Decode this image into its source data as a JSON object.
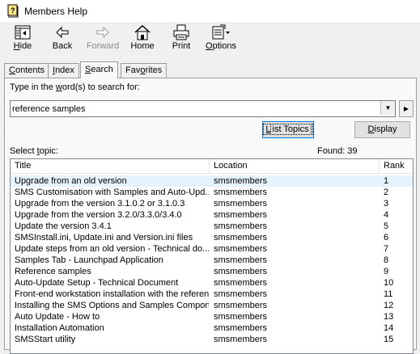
{
  "window": {
    "title": "Members Help"
  },
  "toolbar": {
    "buttons": [
      {
        "label": "Hide",
        "accel": "H",
        "rest": "ide"
      },
      {
        "label": "Back",
        "accel": "",
        "rest": "Back"
      },
      {
        "label": "Forward",
        "accel": "",
        "rest": "Forward"
      },
      {
        "label": "Home",
        "accel": "",
        "rest": "Home"
      },
      {
        "label": "Print",
        "accel": "",
        "rest": "Print"
      },
      {
        "label": "Options",
        "accel": "O",
        "rest": "ptions"
      }
    ]
  },
  "tabs": [
    {
      "label": "Contents",
      "pre": "",
      "accel": "C",
      "post": "ontents"
    },
    {
      "label": "Index",
      "pre": "",
      "accel": "I",
      "post": "ndex"
    },
    {
      "label": "Search",
      "pre": "",
      "accel": "S",
      "post": "earch"
    },
    {
      "label": "Favorites",
      "pre": "Fav",
      "accel": "o",
      "post": "rites"
    }
  ],
  "search": {
    "prompt_pre": "Type in the ",
    "prompt_accel": "w",
    "prompt_post": "ord(s) to search for:",
    "value": "reference samples",
    "list_topics_pre": "",
    "list_topics_accel": "L",
    "list_topics_post": "ist Topics",
    "display_pre": "",
    "display_accel": "D",
    "display_post": "isplay",
    "select_topic_pre": "Select ",
    "select_topic_accel": "t",
    "select_topic_post": "opic:",
    "found": "Found: 39"
  },
  "results": {
    "columns": [
      "Title",
      "Location",
      "Rank"
    ],
    "rows": [
      {
        "title": "Upgrade from an old version",
        "location": "smsmembers",
        "rank": "1"
      },
      {
        "title": "SMS Customisation with Samples and Auto-Upd...",
        "location": "smsmembers",
        "rank": "2"
      },
      {
        "title": "Upgrade from the version 3.1.0.2 or 3.1.0.3",
        "location": "smsmembers",
        "rank": "3"
      },
      {
        "title": "Upgrade from the version 3.2.0/3.3.0/3.4.0",
        "location": "smsmembers",
        "rank": "4"
      },
      {
        "title": "Update the version 3.4.1",
        "location": "smsmembers",
        "rank": "5"
      },
      {
        "title": "SMSInstall.ini, Update.ini and Version.ini files",
        "location": "smsmembers",
        "rank": "6"
      },
      {
        "title": "Update steps from an old version - Technical do...",
        "location": "smsmembers",
        "rank": "7"
      },
      {
        "title": "Samples Tab - Launchpad Application",
        "location": "smsmembers",
        "rank": "8"
      },
      {
        "title": "Reference samples",
        "location": "smsmembers",
        "rank": "9"
      },
      {
        "title": "Auto-Update Setup - Technical Document",
        "location": "smsmembers",
        "rank": "10"
      },
      {
        "title": "Front-end workstation installation with the referen...",
        "location": "smsmembers",
        "rank": "11"
      },
      {
        "title": "Installing the SMS Options and Samples Compon...",
        "location": "smsmembers",
        "rank": "12"
      },
      {
        "title": "Auto Update - How to",
        "location": "smsmembers",
        "rank": "13"
      },
      {
        "title": "Installation Automation",
        "location": "smsmembers",
        "rank": "14"
      },
      {
        "title": "SMSStart utility",
        "location": "smsmembers",
        "rank": "15"
      }
    ]
  },
  "colors": {
    "selected_row": "#e5f3ff",
    "focus_border": "#0078d7"
  }
}
